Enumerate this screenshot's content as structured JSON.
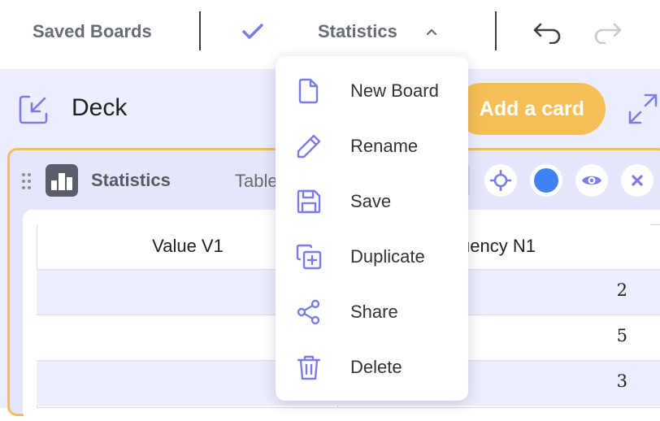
{
  "topbar": {
    "saved_boards": "Saved Boards",
    "board_name": "Statistics"
  },
  "deck": {
    "title": "Deck",
    "add_card": "Add a card"
  },
  "panel": {
    "title": "Statistics",
    "tab": "Table",
    "color": "#3d82f0"
  },
  "table": {
    "headers": [
      "Value V1",
      "uency N1"
    ],
    "rows": [
      {
        "value": "",
        "freq": "2"
      },
      {
        "value": "",
        "freq": "5"
      },
      {
        "value": "",
        "freq": "3"
      }
    ]
  },
  "menu": {
    "items": [
      {
        "label": "New Board",
        "icon": "file-icon"
      },
      {
        "label": "Rename",
        "icon": "pencil-icon"
      },
      {
        "label": "Save",
        "icon": "floppy-icon"
      },
      {
        "label": "Duplicate",
        "icon": "duplicate-icon"
      },
      {
        "label": "Share",
        "icon": "share-icon"
      },
      {
        "label": "Delete",
        "icon": "trash-icon"
      }
    ]
  },
  "colors": {
    "accent": "#7b7ce6",
    "add_card_bg": "#f5bf57",
    "panel_border": "#f3bd5b",
    "workspace_bg": "#eceeff"
  }
}
